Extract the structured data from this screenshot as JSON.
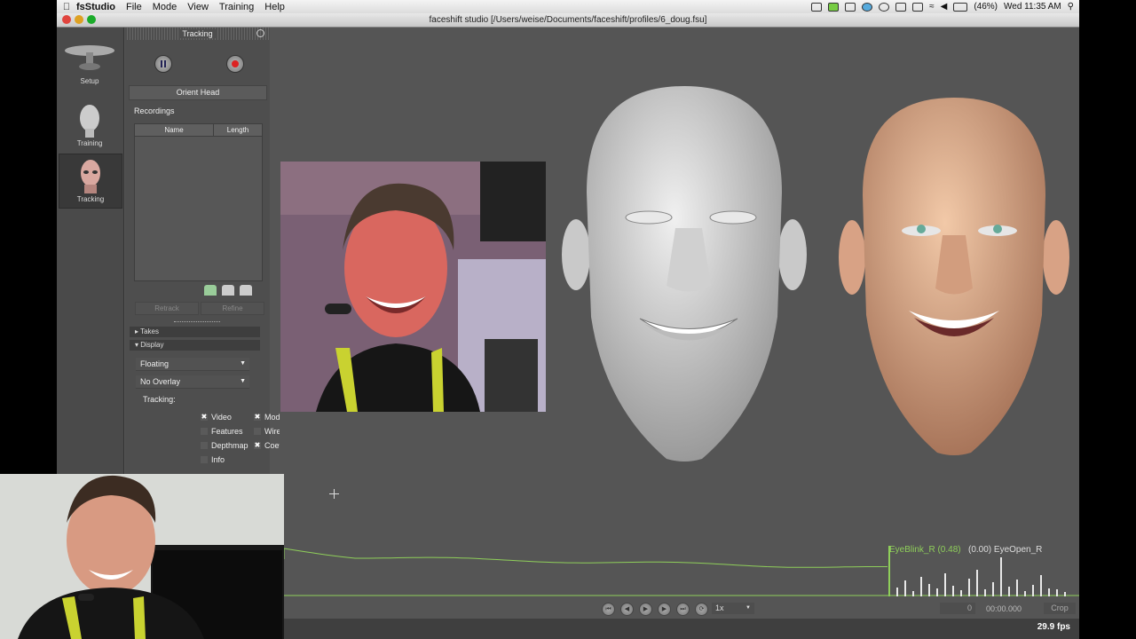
{
  "menubar": {
    "app_name": "fsStudio",
    "menus": [
      "File",
      "Mode",
      "View",
      "Training",
      "Help"
    ],
    "battery": "(46%)",
    "clock": "Wed 11:35 AM"
  },
  "window": {
    "title": "faceshift studio [/Users/weise/Documents/faceshift/profiles/6_doug.fsu]"
  },
  "tools": [
    {
      "label": "Setup"
    },
    {
      "label": "Training"
    },
    {
      "label": "Tracking"
    }
  ],
  "tracking_panel": {
    "title": "Tracking",
    "orient_head": "Orient Head",
    "recordings_label": "Recordings",
    "columns": [
      "Name",
      "Length"
    ],
    "retrack": "Retrack",
    "refine": "Refine",
    "takes_label": "Takes",
    "display_label": "Display",
    "dropdown_mode": "Floating",
    "dropdown_overlay": "No Overlay",
    "tracking_label": "Tracking:",
    "checks": [
      {
        "label": "Video",
        "checked": true
      },
      {
        "label": "Model",
        "checked": true
      },
      {
        "label": "Features",
        "checked": false
      },
      {
        "label": "Wirefram",
        "checked": false
      },
      {
        "label": "Depthmap",
        "checked": false
      },
      {
        "label": "Coefficien",
        "checked": true
      },
      {
        "label": "Info",
        "checked": false
      }
    ]
  },
  "timeline": {
    "left_label": "EyeBlink_R (0.48)",
    "right_label": "(0.00) EyeOpen_R",
    "speed": "1x",
    "frame": "0",
    "time": "00:00.000",
    "crop": "Crop",
    "fps": "29.9 fps",
    "graph_color": "#8fcf5a"
  }
}
